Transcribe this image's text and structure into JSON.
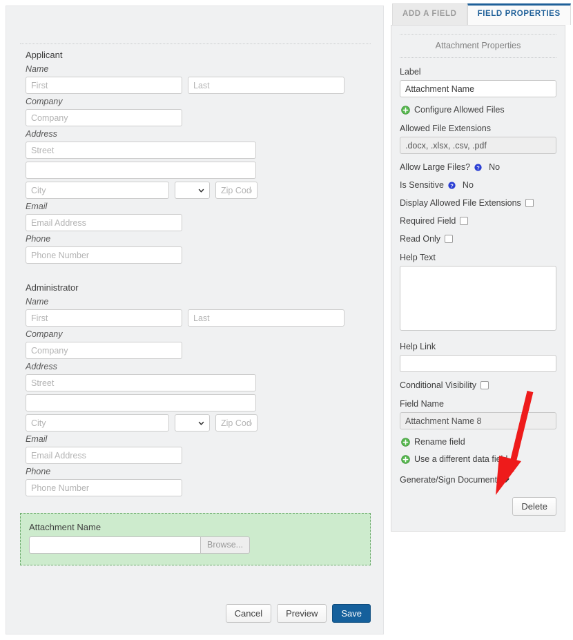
{
  "form": {
    "sections": [
      {
        "title": "Applicant",
        "name_label": "Name",
        "first_placeholder": "First",
        "last_placeholder": "Last",
        "company_label": "Company",
        "company_placeholder": "Company",
        "address_label": "Address",
        "street_placeholder": "Street",
        "street2_placeholder": "",
        "city_placeholder": "City",
        "state_selected": "",
        "zip_placeholder": "Zip Code",
        "email_label": "Email",
        "email_placeholder": "Email Address",
        "phone_label": "Phone",
        "phone_placeholder": "Phone Number"
      },
      {
        "title": "Administrator",
        "name_label": "Name",
        "first_placeholder": "First",
        "last_placeholder": "Last",
        "company_label": "Company",
        "company_placeholder": "Company",
        "address_label": "Address",
        "street_placeholder": "Street",
        "street2_placeholder": "",
        "city_placeholder": "City",
        "state_selected": "",
        "zip_placeholder": "Zip Code",
        "email_label": "Email",
        "email_placeholder": "Email Address",
        "phone_label": "Phone",
        "phone_placeholder": "Phone Number"
      }
    ],
    "attachment": {
      "label": "Attachment Name",
      "file_value": "",
      "browse_label": "Browse..."
    },
    "footer": {
      "cancel_label": "Cancel",
      "preview_label": "Preview",
      "save_label": "Save"
    }
  },
  "properties": {
    "tabs": [
      {
        "label": "ADD A FIELD",
        "active": false
      },
      {
        "label": "FIELD PROPERTIES",
        "active": true
      }
    ],
    "heading": "Attachment Properties",
    "label_label": "Label",
    "label_value": "Attachment Name",
    "configure_allowed_files": "Configure Allowed Files",
    "allowed_ext_label": "Allowed File Extensions",
    "allowed_ext_value": ".docx, .xlsx, .csv, .pdf",
    "allow_large_files_label": "Allow Large Files?",
    "allow_large_files_value": "No",
    "is_sensitive_label": "Is Sensitive",
    "is_sensitive_value": "No",
    "display_allowed_ext_label": "Display Allowed File Extensions",
    "required_field_label": "Required Field",
    "read_only_label": "Read Only",
    "help_text_label": "Help Text",
    "help_text_value": "",
    "help_link_label": "Help Link",
    "help_link_value": "",
    "conditional_visibility_label": "Conditional Visibility",
    "field_name_label": "Field Name",
    "field_name_value": "Attachment Name 8",
    "rename_field": "Rename field",
    "use_different_data_field": "Use a different data field",
    "generate_sign_document": "Generate/Sign Document",
    "delete_label": "Delete"
  },
  "colors": {
    "accent_blue": "#15609c",
    "tab_active_blue": "#1f6099",
    "highlight_green_bg": "#cdebcd",
    "highlight_green_border": "#6aab6a",
    "annotation_red": "#ee1b1b",
    "panel_bg": "#f0f1f2"
  },
  "annotation": {
    "type": "arrow",
    "color": "#ee1b1b",
    "points_to": "Generate/Sign Document"
  }
}
